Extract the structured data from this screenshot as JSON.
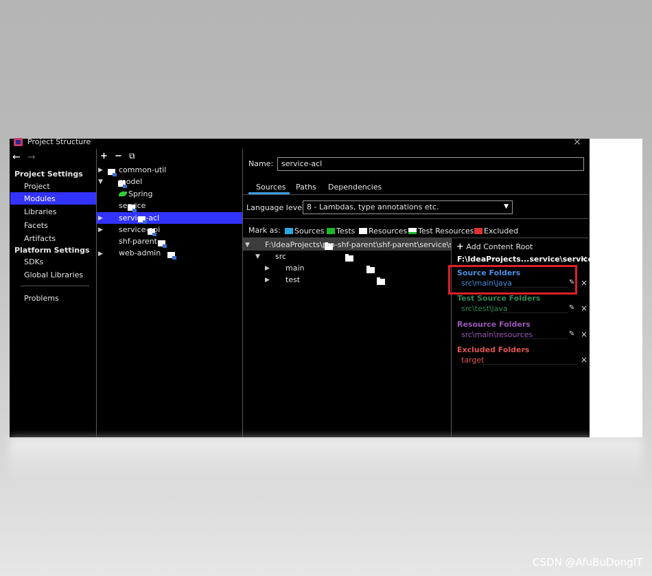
{
  "window": {
    "title": "Project Structure",
    "close_label": "×"
  },
  "nav": {
    "back": "←",
    "forward": "→"
  },
  "sidebar": {
    "project_settings_header": "Project Settings",
    "project_items": [
      "Project",
      "Modules",
      "Libraries",
      "Facets",
      "Artifacts"
    ],
    "selected": "Modules",
    "platform_settings_header": "Platform Settings",
    "platform_items": [
      "SDKs",
      "Global Libraries"
    ],
    "problems": "Problems"
  },
  "module_toolbar": {
    "add": "+",
    "remove": "−",
    "copy": "⧉"
  },
  "modules": [
    {
      "name": "common-util",
      "expander": "▶"
    },
    {
      "name": "model",
      "expander": "▼"
    },
    {
      "name": "Spring",
      "expander": "",
      "child": true
    },
    {
      "name": "service",
      "expander": ""
    },
    {
      "name": "service-acl",
      "expander": "▶",
      "selected": true
    },
    {
      "name": "service-api",
      "expander": "▶"
    },
    {
      "name": "shf-parent",
      "expander": ""
    },
    {
      "name": "web-admin",
      "expander": "▶"
    }
  ],
  "main": {
    "name_label": "Name:",
    "name_value": "service-acl",
    "tabs": [
      "Sources",
      "Paths",
      "Dependencies"
    ],
    "active_tab": "Sources",
    "language_label": "Language level:",
    "language_value": "8 - Lambdas, type annotations etc.",
    "mark_as_label": "Mark as:",
    "mark_as": [
      {
        "label": "Sources",
        "color": "#2aa8e0"
      },
      {
        "label": "Tests",
        "color": "#1bb82a"
      },
      {
        "label": "Resources",
        "color": "#ffffff"
      },
      {
        "label": "Test Resources",
        "color": "#ffffff"
      },
      {
        "label": "Excluded",
        "color": "#e03030"
      }
    ],
    "tree": {
      "root": "F:\\IdeaProjects\\pro-shf-parent\\shf-parent\\service\\servic",
      "src": "src",
      "main": "main",
      "test": "test"
    }
  },
  "roots_panel": {
    "add_content_root": "Add Content Root",
    "root_path": "F:\\IdeaProjects...service\\service-acl",
    "sections": [
      {
        "title": "Source Folders",
        "path": "src\\main\\java",
        "color": "#4a90e2",
        "highlighted": true
      },
      {
        "title": "Test Source Folders",
        "path": "src\\test\\java",
        "color": "#2e8b57"
      },
      {
        "title": "Resource Folders",
        "path": "src\\main\\resources",
        "color": "#9b59b6"
      },
      {
        "title": "Excluded Folders",
        "path": "target",
        "color": "#e05555"
      }
    ]
  },
  "watermark": "CSDN @AfuBuDongIT"
}
